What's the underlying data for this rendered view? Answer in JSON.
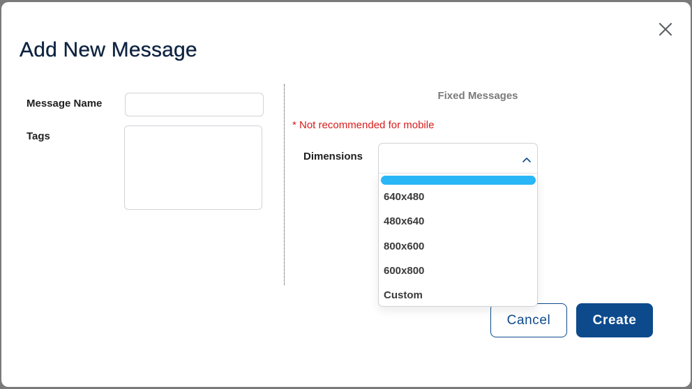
{
  "dialog": {
    "title": "Add New Message",
    "close_icon": "close-icon"
  },
  "form": {
    "message_name_label": "Message Name",
    "message_name_value": "",
    "tags_label": "Tags",
    "tags_value": ""
  },
  "fixed_messages": {
    "heading": "Fixed Messages",
    "warning": "* Not recommended for mobile",
    "dimensions_label": "Dimensions",
    "dimensions_value": "",
    "chevron_icon": "chevron-up-icon",
    "options": [
      "640x480",
      "480x640",
      "800x600",
      "600x800",
      "Custom"
    ]
  },
  "actions": {
    "cancel_label": "Cancel",
    "create_label": "Create"
  },
  "colors": {
    "primary": "#0c4a8c",
    "title": "#0d2340",
    "warning": "#d81b1b",
    "highlight": "#29b6f6"
  }
}
